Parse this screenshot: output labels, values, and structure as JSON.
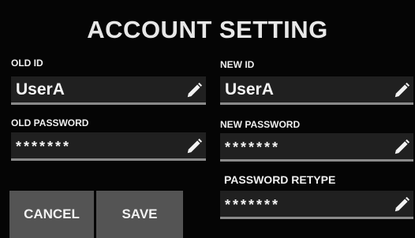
{
  "title": "ACCOUNT SETTING",
  "old_id": {
    "label": "OLD ID",
    "value": "UserA"
  },
  "new_id": {
    "label": "NEW ID",
    "value": "UserA"
  },
  "old_password": {
    "label": "OLD PASSWORD",
    "value": "*******"
  },
  "new_password": {
    "label": "NEW PASSWORD",
    "value": "*******"
  },
  "password_retype": {
    "label": "PASSWORD RETYPE",
    "value": "*******"
  },
  "buttons": {
    "cancel": "CANCEL",
    "save": "SAVE"
  },
  "icons": {
    "edit": "pencil-icon"
  },
  "colors": {
    "background": "#050505",
    "field": "#202020",
    "field_underline": "#8a8a8a",
    "button": "#545454",
    "text": "#ffffff"
  }
}
